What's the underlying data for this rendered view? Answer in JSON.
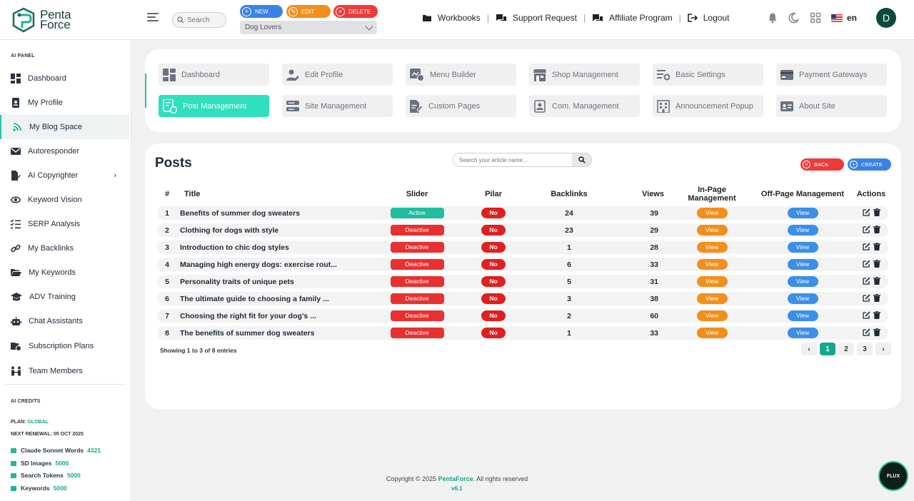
{
  "app": {
    "logo_line1": "Penta",
    "logo_line2": "Force"
  },
  "header": {
    "search_placeholder": "Search",
    "new_label": "NEW",
    "edit_label": "EDIT",
    "delete_label": "DELETE",
    "project_selected": "Dog Lovers",
    "nav": {
      "workbooks": "Workbooks",
      "support": "Support Request",
      "affiliate": "Affiliate Program",
      "logout": "Logout",
      "separator": "|"
    },
    "language": "en",
    "avatar_initial": "D"
  },
  "sidebar": {
    "panel_title": "AI PANEL",
    "items": [
      {
        "label": "Dashboard"
      },
      {
        "label": "My Profile"
      },
      {
        "label": "My Blog Space"
      },
      {
        "label": "Autoresponder"
      },
      {
        "label": "AI Copyrighter",
        "arrow": "›"
      },
      {
        "label": "Keyword Vision"
      },
      {
        "label": "SERP Analysis"
      },
      {
        "label": "My Backlinks"
      },
      {
        "label": "My Keywords"
      },
      {
        "label": "ADV Training"
      },
      {
        "label": "Chat Assistants"
      },
      {
        "label": "Subscription Plans"
      },
      {
        "label": "Team Members"
      }
    ],
    "credits_title": "AI CREDITS",
    "plan_label": "PLAN:",
    "plan_value": "GLOBAL",
    "renewal": "NEXT RENEWAL: 05 OCT 2025",
    "credits": [
      {
        "label": "Claude Sonnet Words",
        "value": "4321"
      },
      {
        "label": "SD Images",
        "value": "5000"
      },
      {
        "label": "Search Tokens",
        "value": "5000"
      },
      {
        "label": "Keywords",
        "value": "5000"
      }
    ]
  },
  "menu_buttons": [
    {
      "label": "Dashboard"
    },
    {
      "label": "Edit Profile"
    },
    {
      "label": "Menu Builder"
    },
    {
      "label": "Shop Management"
    },
    {
      "label": "Basic Settings"
    },
    {
      "label": "Payment Gateways"
    },
    {
      "label": "Post Management"
    },
    {
      "label": "Site Management"
    },
    {
      "label": "Custom Pages"
    },
    {
      "label": "Com. Management"
    },
    {
      "label": "Announcement Popup"
    },
    {
      "label": "About Site"
    }
  ],
  "posts": {
    "title": "Posts",
    "search_placeholder": "Search your article name...",
    "back_label": "BACK",
    "create_label": "CREATE",
    "columns": [
      "#",
      "Title",
      "Slider",
      "Pilar",
      "Backlinks",
      "Views",
      "In-Page Management",
      "Off-Page Management",
      "Actions"
    ],
    "rows": [
      {
        "num": "1",
        "title": "Benefits of summer dog sweaters",
        "slider": "Active",
        "pilar": "No",
        "backlinks": "24",
        "views": "39",
        "inpage": "View",
        "offpage": "View"
      },
      {
        "num": "2",
        "title": "Clothing for dogs with style",
        "slider": "Deactive",
        "pilar": "No",
        "backlinks": "23",
        "views": "29",
        "inpage": "View",
        "offpage": "View"
      },
      {
        "num": "3",
        "title": "Introduction to chic dog styles",
        "slider": "Deactive",
        "pilar": "No",
        "backlinks": "1",
        "views": "28",
        "inpage": "View",
        "offpage": "View"
      },
      {
        "num": "4",
        "title": "Managing high energy dogs: exercise rout...",
        "slider": "Deactive",
        "pilar": "No",
        "backlinks": "6",
        "views": "33",
        "inpage": "View",
        "offpage": "View"
      },
      {
        "num": "5",
        "title": "Personality traits of unique pets",
        "slider": "Deactive",
        "pilar": "No",
        "backlinks": "5",
        "views": "31",
        "inpage": "View",
        "offpage": "View"
      },
      {
        "num": "6",
        "title": "The ultimate guide to choosing a family ...",
        "slider": "Deactive",
        "pilar": "No",
        "backlinks": "3",
        "views": "38",
        "inpage": "View",
        "offpage": "View"
      },
      {
        "num": "7",
        "title": "Choosing the right fit for your dog’s ...",
        "slider": "Deactive",
        "pilar": "No",
        "backlinks": "2",
        "views": "60",
        "inpage": "View",
        "offpage": "View"
      },
      {
        "num": "8",
        "title": "The benefits of summer dog sweaters",
        "slider": "Deactive",
        "pilar": "No",
        "backlinks": "1",
        "views": "33",
        "inpage": "View",
        "offpage": "View"
      }
    ],
    "showing": "Showing 1 to 3 of 8 entries",
    "pagination": {
      "prev": "‹",
      "pages": [
        "1",
        "2",
        "3"
      ],
      "next": "›"
    }
  },
  "footer": {
    "copyright_prefix": "Copyright © 2025 ",
    "brand": "PentaForce",
    "copyright_suffix": ". All rights reserved",
    "version": "v6.1"
  },
  "flux_label": "FLUX",
  "colors": {
    "accent": "#24c6a8",
    "active_menu": "#2fe0be",
    "brand": "#11a98d",
    "danger": "#e93030",
    "warning": "#f28f1a",
    "info": "#3b82e6"
  }
}
